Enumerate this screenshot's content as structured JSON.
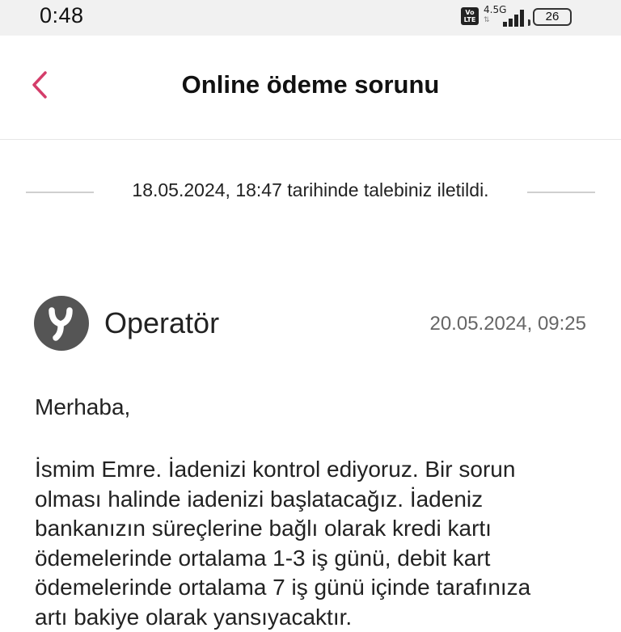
{
  "status_bar": {
    "time": "0:48",
    "network": "4.5G",
    "volte": "Vo LTE",
    "battery": "26"
  },
  "header": {
    "title": "Online ödeme sorunu",
    "back_icon": "chevron-left-icon",
    "accent_color": "#d43d6a"
  },
  "request_notice": {
    "text": "18.05.2024, 18:47 tarihinde talebiniz iletildi."
  },
  "message": {
    "sender": "Operatör",
    "avatar_letter": "Y",
    "timestamp": "20.05.2024, 09:25",
    "greeting": "Merhaba,",
    "body_lines": [
      "İsmim Emre. İadenizi kontrol ediyoruz. Bir sorun",
      "olması halinde iadenizi başlatacağız. İadeniz",
      "bankanızın süreçlerine bağlı olarak kredi kartı",
      "ödemelerinde ortalama 1-3 iş günü, debit kart",
      "ödemelerinde ortalama 7 iş günü içinde tarafınıza",
      "artı bakiye olarak yansıyacaktır."
    ]
  }
}
